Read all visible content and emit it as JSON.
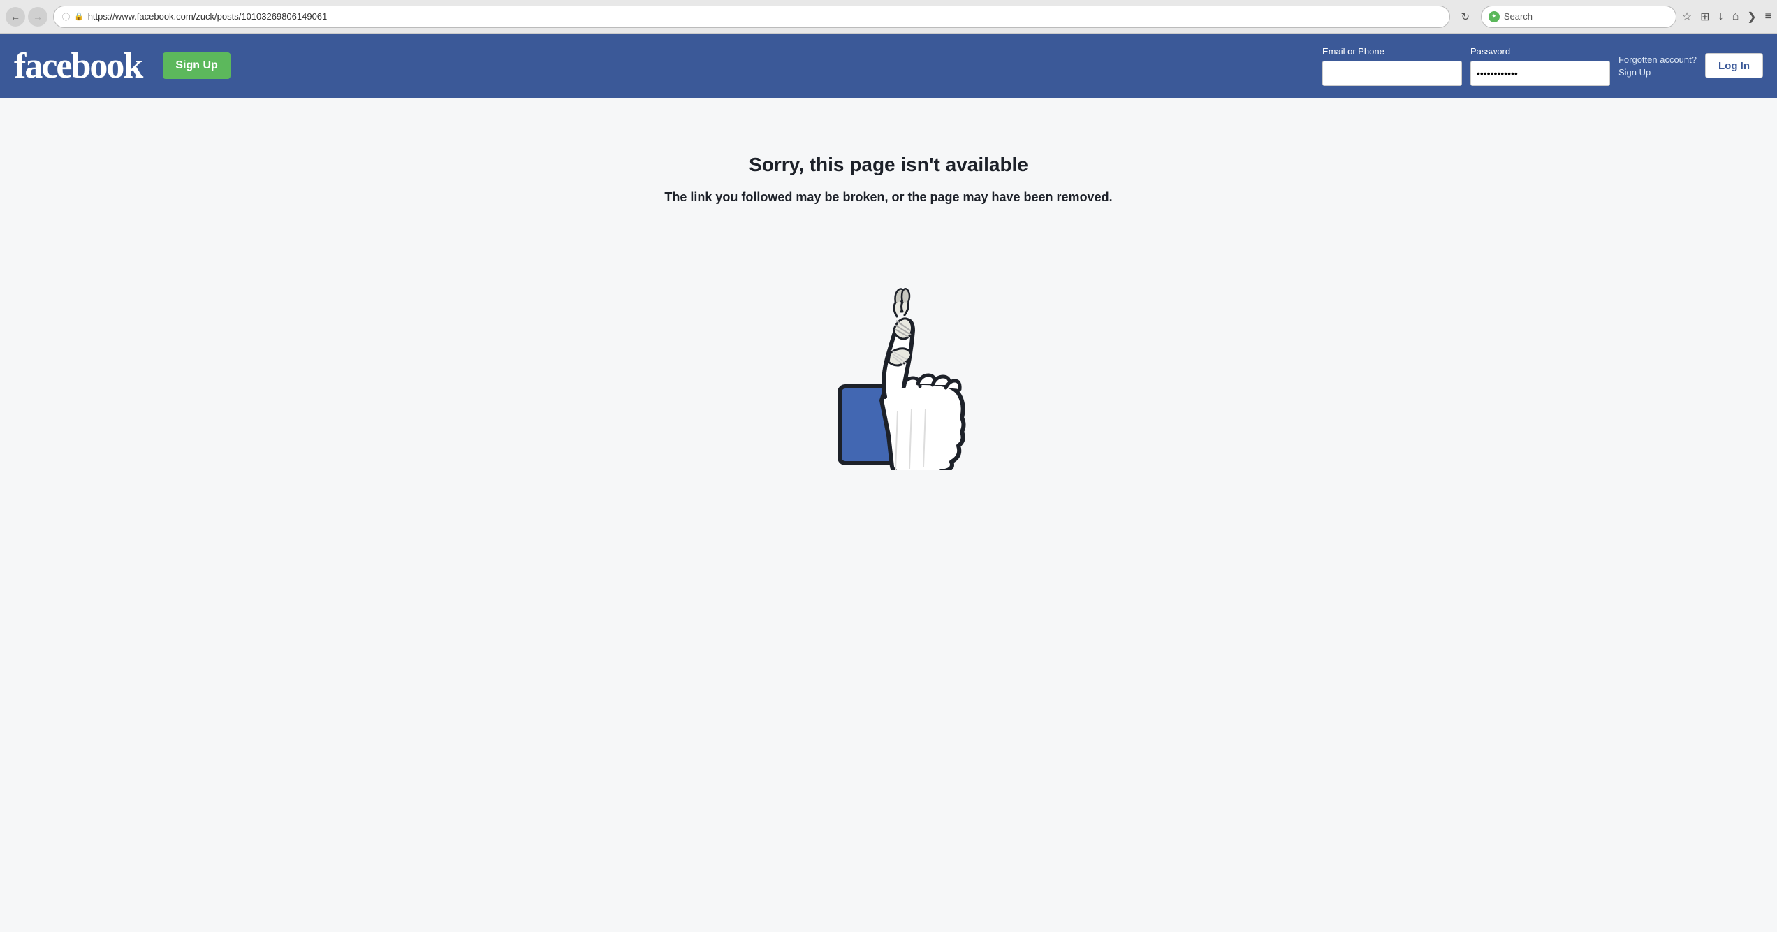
{
  "browser": {
    "back_label": "←",
    "forward_label": "→",
    "info_icon": "ℹ",
    "lock_icon": "🔒",
    "url": "https://www.facebook.com/zuck/posts/10103269806149061",
    "reload_label": "↻",
    "search_placeholder": "Search",
    "search_label": "Search",
    "star_icon": "☆",
    "grid_icon": "⊞",
    "download_icon": "↓",
    "home_icon": "⌂",
    "pocket_icon": "❯",
    "menu_icon": "≡"
  },
  "header": {
    "logo": "facebook",
    "signup_label": "Sign Up",
    "email_label": "Email or Phone",
    "email_value": "",
    "email_placeholder": "",
    "password_label": "Password",
    "password_value": "••••••••••••",
    "forgotten_label": "Forgotten account?",
    "signup_link_label": "Sign Up",
    "login_label": "Log In"
  },
  "main": {
    "error_title": "Sorry, this page isn't available",
    "error_subtitle": "The link you followed may be broken, or the page may have been removed."
  },
  "colors": {
    "fb_blue": "#3b5998",
    "fb_green": "#5cb85c",
    "fb_bg": "#f6f7f8",
    "fb_thumb_blue": "#4267b2",
    "fb_thumb_dark": "#1d2129"
  }
}
